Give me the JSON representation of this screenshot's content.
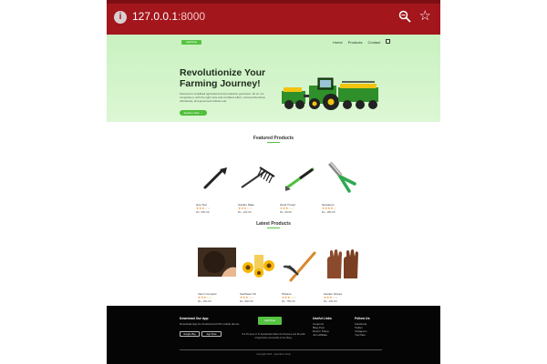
{
  "browser": {
    "url_host": "127.0.0.1",
    "url_port": ":8000"
  },
  "header": {
    "logo": "AgriShop",
    "nav": [
      "Home",
      "Products",
      "Contact"
    ]
  },
  "hero": {
    "title": "Revolutionize Your Farming Journey!",
    "subtitle": "Succeed in simplified agricultural and productive goodness. Fit on our comparison, with the right tools and confident effort, success flourishes effortlessly, and greenness follows suit.",
    "button": "Explore Now →"
  },
  "featured": {
    "title": "Featured Products",
    "products": [
      {
        "name": "Hoe Tool",
        "stars": "★★★☆☆",
        "price": "Rs. 250.00"
      },
      {
        "name": "Garden Rake",
        "stars": "★★★☆☆",
        "price": "Rs. 120.00"
      },
      {
        "name": "Hand Trowel",
        "stars": "★★★☆☆",
        "price": "Rs. 90.00"
      },
      {
        "name": "Secateurs",
        "stars": "★★★★☆",
        "price": "Rs. 180.00"
      }
    ]
  },
  "latest": {
    "title": "Latest Products",
    "products": [
      {
        "name": "Vermi Compost",
        "stars": "★★★☆☆",
        "price": "Rs. 150.00"
      },
      {
        "name": "Sunflower Oil",
        "stars": "★★★☆☆",
        "price": "Rs. 560.00"
      },
      {
        "name": "Pickaxe",
        "stars": "★★★☆☆",
        "price": "Rs. 750.00"
      },
      {
        "name": "Garden Gloves",
        "stars": "★★★☆☆",
        "price": "Rs. 100.00"
      }
    ]
  },
  "footer": {
    "app_title": "Download Our App",
    "app_text": "Download App for Android and iOS mobile phone.",
    "google_play": "Google Play",
    "app_store": "App Store",
    "logo": "AgriShop",
    "description": "Our Purpose Is To Sustainably Make the Pleasure and Benefits of Agriculture Accessible to the Many.",
    "useful_links_title": "Useful Links",
    "useful_links": [
      "Coupons",
      "Blog Post",
      "Return Policy",
      "Join Affiliate"
    ],
    "follow_title": "Follow Us",
    "follow_links": [
      "Facebook",
      "Twitter",
      "Instagram",
      "YouTube"
    ],
    "copyright": "Copyright 2023 - Agriculture Shop"
  }
}
